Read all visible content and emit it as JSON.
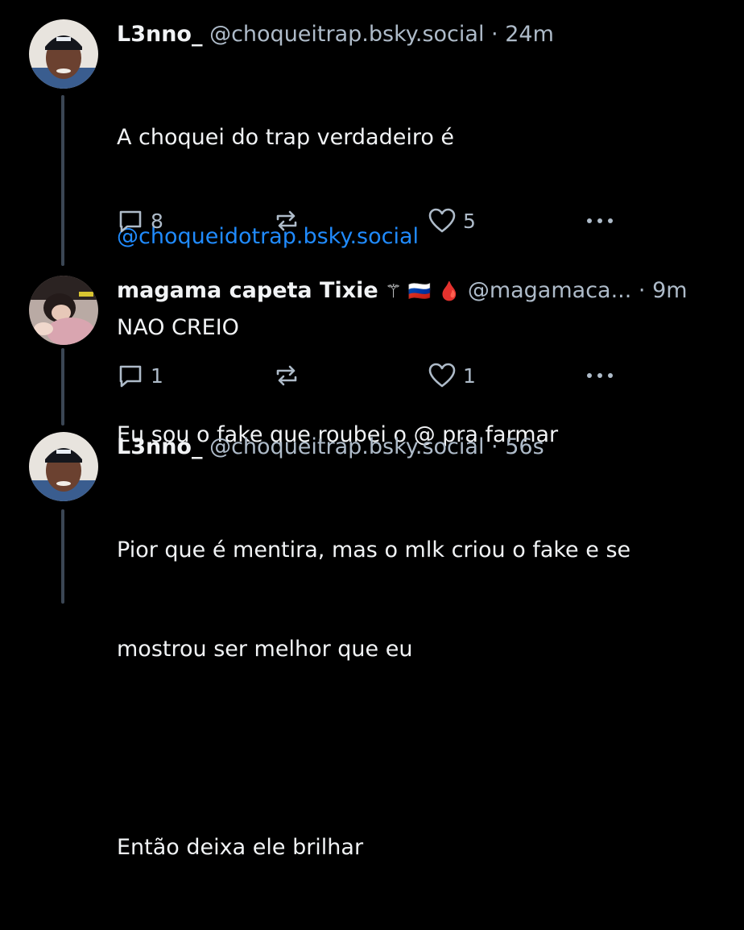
{
  "posts": [
    {
      "author": {
        "display_name": "L3nno_",
        "handle": "@choqueitrap.bsky.social"
      },
      "separator": "·",
      "time": "24m",
      "text_lines": [
        "A choquei do trap verdadeiro é"
      ],
      "mention": "@choqueidotrap.bsky.social",
      "text_after": "Eu sou o fake que roubei o @ pra farmar",
      "actions": {
        "replies": "8",
        "reposts": "",
        "likes": "5"
      }
    },
    {
      "author": {
        "display_name": "magama capeta Tixie",
        "name_emojis": "⚚ 🇷🇺 🩸",
        "handle": "@magamaca..."
      },
      "separator": "·",
      "time": "9m",
      "text": "NAO CREIO",
      "actions": {
        "replies": "1",
        "reposts": "",
        "likes": "1"
      }
    },
    {
      "author": {
        "display_name": "L3nno_",
        "handle": "@choqueitrap.bsky.social"
      },
      "separator": "·",
      "time": "56s",
      "text_lines": [
        "Pior que é mentira, mas o mlk criou o fake e se",
        "mostrou ser melhor que eu"
      ],
      "text_after": "Então deixa ele brilhar"
    }
  ],
  "colors": {
    "background": "#000000",
    "text": "#f1f3f5",
    "muted": "#aebbc9",
    "link": "#208bfe",
    "thread": "#3b4654"
  },
  "icons": [
    "reply-icon",
    "repost-icon",
    "like-icon",
    "more-icon"
  ]
}
